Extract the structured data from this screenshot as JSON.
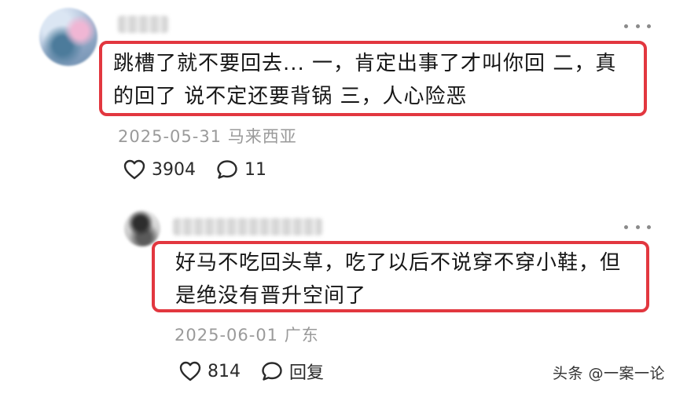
{
  "comments": [
    {
      "text_line1": "跳槽了就不要回去... 一，肯定出事了才叫你回 二，真",
      "text_line2": "的回了 说不定还要背锅 三，人心险恶",
      "date": "2025-05-31",
      "location": "马来西亚",
      "likes": "3904",
      "replies": "11",
      "like_icon": "heart-icon",
      "reply_icon": "speech-bubble-icon"
    },
    {
      "text_line1": "好马不吃回头草，吃了以后不说穿不穿小鞋，但",
      "text_line2": "是绝没有晋升空间了",
      "date": "2025-06-01",
      "location": "广东",
      "likes": "814",
      "reply_label": "回复",
      "like_icon": "heart-icon",
      "reply_icon": "speech-bubble-icon"
    }
  ],
  "watermark": "头条 @一案一论",
  "colors": {
    "highlight_border": "#e2373f",
    "meta_text": "#9a9a9a",
    "more_dots": "#8a8a8a"
  }
}
